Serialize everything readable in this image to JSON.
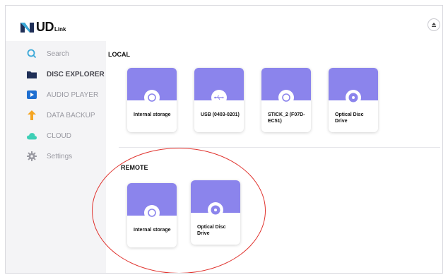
{
  "header": {
    "logo_main": "UD",
    "logo_sub": "Link",
    "eject_icon": "eject-icon"
  },
  "sidebar": {
    "items": [
      {
        "label": "Search",
        "icon": "search-icon",
        "active": false
      },
      {
        "label": "DISC EXPLORER",
        "icon": "folder-icon",
        "active": true
      },
      {
        "label": "AUDIO PLAYER",
        "icon": "play-icon",
        "active": false
      },
      {
        "label": "DATA BACKUP",
        "icon": "backup-icon",
        "active": false
      },
      {
        "label": "CLOUD",
        "icon": "cloud-icon",
        "active": false
      },
      {
        "label": "Settings",
        "icon": "gear-icon",
        "active": false
      }
    ]
  },
  "main": {
    "local_title": "LOCAL",
    "remote_title": "REMOTE",
    "local_devices": [
      {
        "label": "Internal storage",
        "icon": "drive-icon"
      },
      {
        "label": "USB (0403-0201)",
        "icon": "usb-icon"
      },
      {
        "label": "STICK_2 (F07D-EC51)",
        "icon": "drive-icon"
      },
      {
        "label": "Optical Disc Drive",
        "icon": "disc-icon"
      }
    ],
    "remote_devices": [
      {
        "label": "Internal storage",
        "icon": "drive-icon"
      },
      {
        "label": "Optical Disc Drive",
        "icon": "disc-icon"
      }
    ]
  },
  "colors": {
    "accent": "#8b84ec",
    "sidebar_bg": "#f4f4f6",
    "highlight_circle": "#e0332e",
    "nav_icon_blue": "#3aa8d8",
    "nav_icon_navy": "#1f2f57",
    "nav_icon_orange": "#f5a623",
    "nav_icon_cloud": "#3ecfb6"
  }
}
